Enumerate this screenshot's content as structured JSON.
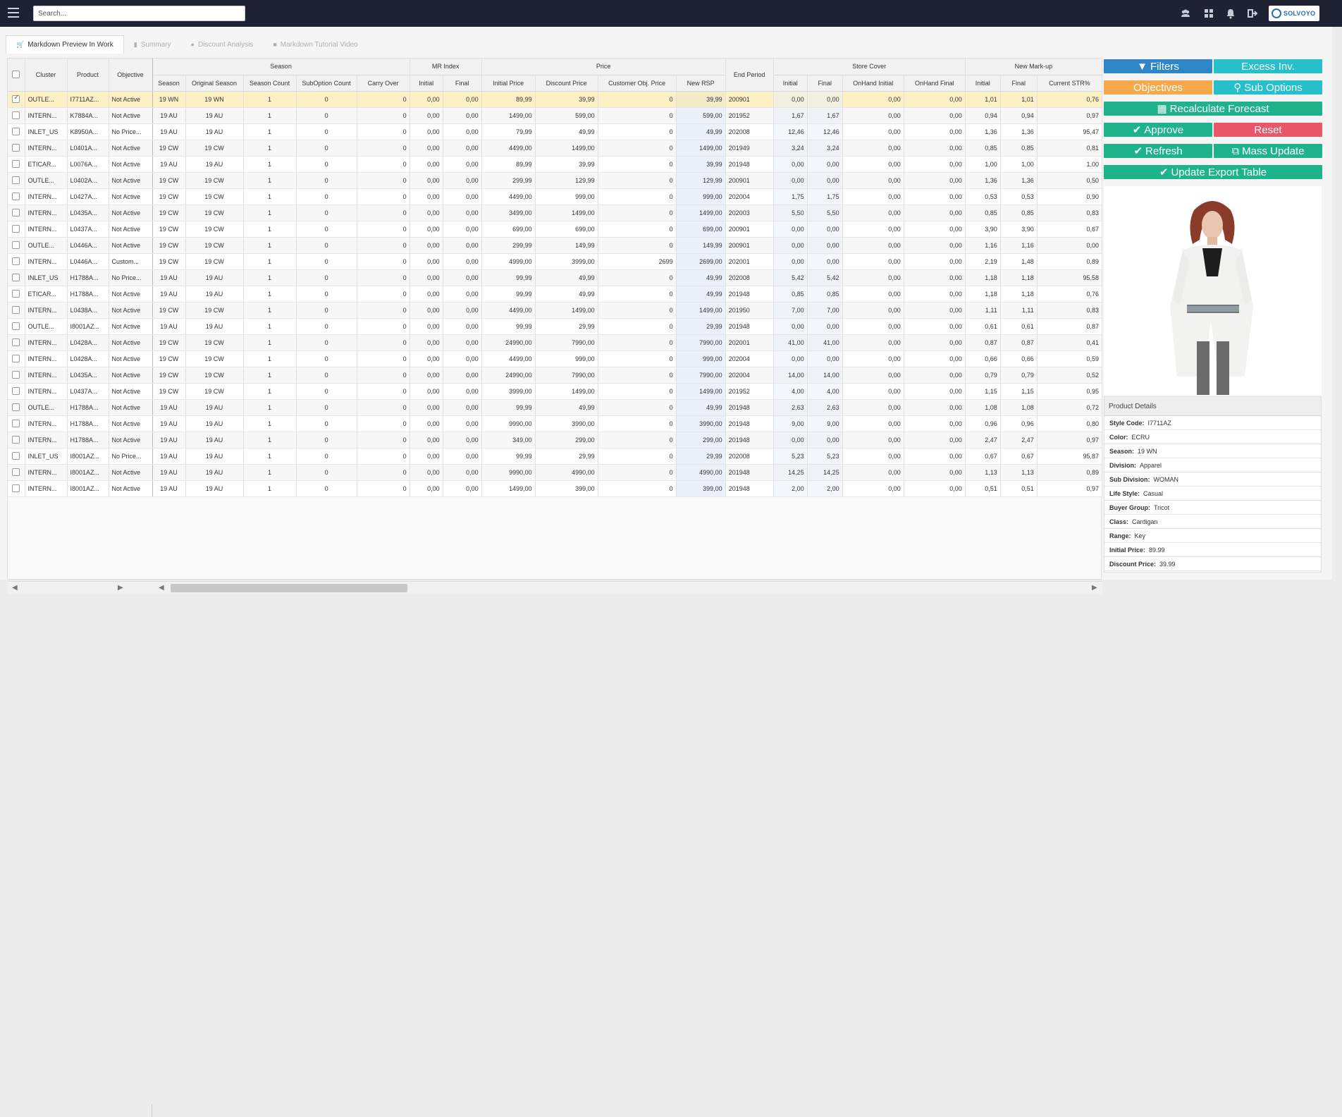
{
  "search": {
    "placeholder": "Search..."
  },
  "logo": {
    "text": "SOLVOYO"
  },
  "tabs": [
    {
      "label": "Markdown Preview In Work",
      "icon": "cart-icon",
      "active": true
    },
    {
      "label": "Summary",
      "icon": "bar-chart-icon",
      "active": false
    },
    {
      "label": "Discount Analysis",
      "icon": "pie-chart-icon",
      "active": false
    },
    {
      "label": "Markdown Tutorial Video",
      "icon": "video-icon",
      "active": false
    }
  ],
  "grid": {
    "group_headers": {
      "season": "Season",
      "mr_index": "MR Index",
      "price": "Price",
      "store_cover": "Store Cover",
      "new_markup": "New Mark-up"
    },
    "frozen_headers": {
      "cluster": "Cluster",
      "product": "Product",
      "objective": "Objective"
    },
    "end_period_header": "End Period",
    "sub_headers": {
      "season": "Season",
      "original_season": "Original Season",
      "season_count": "Season Count",
      "suboption_count": "SubOption Count",
      "carry_over": "Carry Over",
      "mr_initial": "Initial",
      "mr_final": "Final",
      "initial_price": "Initial Price",
      "discount_price": "Discount Price",
      "customer_obj_price": "Customer Obj. Price",
      "new_rsp": "New RSP",
      "sc_initial": "Initial",
      "sc_final": "Final",
      "onhand_initial": "OnHand Initial",
      "onhand_final": "OnHand Final",
      "nm_initial": "Initial",
      "nm_final": "Final",
      "current_str": "Current STR%"
    },
    "rows": [
      [
        "OUTLE...",
        "I7711AZ...",
        "Not Active",
        "19 WN",
        "19 WN",
        "1",
        "0",
        "0",
        "0,00",
        "0,00",
        "89,99",
        "39,99",
        "0",
        "39,99",
        "200901",
        "0,00",
        "0,00",
        "0,00",
        "0,00",
        "1,01",
        "1,01",
        "0,76"
      ],
      [
        "INTERN...",
        "K7884A...",
        "Not Active",
        "19 AU",
        "19 AU",
        "1",
        "0",
        "0",
        "0,00",
        "0,00",
        "1499,00",
        "599,00",
        "0",
        "599,00",
        "201952",
        "1,67",
        "1,67",
        "0,00",
        "0,00",
        "0,94",
        "0,94",
        "0,97"
      ],
      [
        "INLET_US",
        "K8950A...",
        "No Price...",
        "19 AU",
        "19 AU",
        "1",
        "0",
        "0",
        "0,00",
        "0,00",
        "79,99",
        "49,99",
        "0",
        "49,99",
        "202008",
        "12,46",
        "12,46",
        "0,00",
        "0,00",
        "1,36",
        "1,36",
        "95,47"
      ],
      [
        "INTERN...",
        "L0401A...",
        "Not Active",
        "19 CW",
        "19 CW",
        "1",
        "0",
        "0",
        "0,00",
        "0,00",
        "4499,00",
        "1499,00",
        "0",
        "1499,00",
        "201949",
        "3,24",
        "3,24",
        "0,00",
        "0,00",
        "0,85",
        "0,85",
        "0,81"
      ],
      [
        "ETICAR...",
        "L0076A...",
        "Not Active",
        "19 AU",
        "19 AU",
        "1",
        "0",
        "0",
        "0,00",
        "0,00",
        "89,99",
        "39,99",
        "0",
        "39,99",
        "201948",
        "0,00",
        "0,00",
        "0,00",
        "0,00",
        "1,00",
        "1,00",
        "1,00"
      ],
      [
        "OUTLE...",
        "L0402A...",
        "Not Active",
        "19 CW",
        "19 CW",
        "1",
        "0",
        "0",
        "0,00",
        "0,00",
        "299,99",
        "129,99",
        "0",
        "129,99",
        "200901",
        "0,00",
        "0,00",
        "0,00",
        "0,00",
        "1,36",
        "1,36",
        "0,50"
      ],
      [
        "INTERN...",
        "L0427A...",
        "Not Active",
        "19 CW",
        "19 CW",
        "1",
        "0",
        "0",
        "0,00",
        "0,00",
        "4499,00",
        "999,00",
        "0",
        "999,00",
        "202004",
        "1,75",
        "1,75",
        "0,00",
        "0,00",
        "0,53",
        "0,53",
        "0,90"
      ],
      [
        "INTERN...",
        "L0435A...",
        "Not Active",
        "19 CW",
        "19 CW",
        "1",
        "0",
        "0",
        "0,00",
        "0,00",
        "3499,00",
        "1499,00",
        "0",
        "1499,00",
        "202003",
        "5,50",
        "5,50",
        "0,00",
        "0,00",
        "0,85",
        "0,85",
        "0,83"
      ],
      [
        "INTERN...",
        "L0437A...",
        "Not Active",
        "19 CW",
        "19 CW",
        "1",
        "0",
        "0",
        "0,00",
        "0,00",
        "699,00",
        "699,00",
        "0",
        "699,00",
        "200901",
        "0,00",
        "0,00",
        "0,00",
        "0,00",
        "3,90",
        "3,90",
        "0,67"
      ],
      [
        "OUTLE...",
        "L0446A...",
        "Not Active",
        "19 CW",
        "19 CW",
        "1",
        "0",
        "0",
        "0,00",
        "0,00",
        "299,99",
        "149,99",
        "0",
        "149,99",
        "200901",
        "0,00",
        "0,00",
        "0,00",
        "0,00",
        "1,16",
        "1,16",
        "0,00"
      ],
      [
        "INTERN...",
        "L0446A...",
        "Custom...",
        "19 CW",
        "19 CW",
        "1",
        "0",
        "0",
        "0,00",
        "0,00",
        "4999,00",
        "3999,00",
        "2699",
        "2699,00",
        "202001",
        "0,00",
        "0,00",
        "0,00",
        "0,00",
        "2,19",
        "1,48",
        "0,89"
      ],
      [
        "INLET_US",
        "H1788A...",
        "No Price...",
        "19 AU",
        "19 AU",
        "1",
        "0",
        "0",
        "0,00",
        "0,00",
        "99,99",
        "49,99",
        "0",
        "49,99",
        "202008",
        "5,42",
        "5,42",
        "0,00",
        "0,00",
        "1,18",
        "1,18",
        "95,58"
      ],
      [
        "ETICAR...",
        "H1788A...",
        "Not Active",
        "19 AU",
        "19 AU",
        "1",
        "0",
        "0",
        "0,00",
        "0,00",
        "99,99",
        "49,99",
        "0",
        "49,99",
        "201948",
        "0,85",
        "0,85",
        "0,00",
        "0,00",
        "1,18",
        "1,18",
        "0,76"
      ],
      [
        "INTERN...",
        "L0438A...",
        "Not Active",
        "19 CW",
        "19 CW",
        "1",
        "0",
        "0",
        "0,00",
        "0,00",
        "4499,00",
        "1499,00",
        "0",
        "1499,00",
        "201950",
        "7,00",
        "7,00",
        "0,00",
        "0,00",
        "1,11",
        "1,11",
        "0,83"
      ],
      [
        "OUTLE...",
        "I8001AZ...",
        "Not Active",
        "19 AU",
        "19 AU",
        "1",
        "0",
        "0",
        "0,00",
        "0,00",
        "99,99",
        "29,99",
        "0",
        "29,99",
        "201948",
        "0,00",
        "0,00",
        "0,00",
        "0,00",
        "0,61",
        "0,61",
        "0,87"
      ],
      [
        "INTERN...",
        "L0428A...",
        "Not Active",
        "19 CW",
        "19 CW",
        "1",
        "0",
        "0",
        "0,00",
        "0,00",
        "24990,00",
        "7990,00",
        "0",
        "7990,00",
        "202001",
        "41,00",
        "41,00",
        "0,00",
        "0,00",
        "0,87",
        "0,87",
        "0,41"
      ],
      [
        "INTERN...",
        "L0428A...",
        "Not Active",
        "19 CW",
        "19 CW",
        "1",
        "0",
        "0",
        "0,00",
        "0,00",
        "4499,00",
        "999,00",
        "0",
        "999,00",
        "202004",
        "0,00",
        "0,00",
        "0,00",
        "0,00",
        "0,66",
        "0,66",
        "0,59"
      ],
      [
        "INTERN...",
        "L0435A...",
        "Not Active",
        "19 CW",
        "19 CW",
        "1",
        "0",
        "0",
        "0,00",
        "0,00",
        "24990,00",
        "7990,00",
        "0",
        "7990,00",
        "202004",
        "14,00",
        "14,00",
        "0,00",
        "0,00",
        "0,79",
        "0,79",
        "0,52"
      ],
      [
        "INTERN...",
        "L0437A...",
        "Not Active",
        "19 CW",
        "19 CW",
        "1",
        "0",
        "0",
        "0,00",
        "0,00",
        "3999,00",
        "1499,00",
        "0",
        "1499,00",
        "201952",
        "4,00",
        "4,00",
        "0,00",
        "0,00",
        "1,15",
        "1,15",
        "0,95"
      ],
      [
        "OUTLE...",
        "H1788A...",
        "Not Active",
        "19 AU",
        "19 AU",
        "1",
        "0",
        "0",
        "0,00",
        "0,00",
        "99,99",
        "49,99",
        "0",
        "49,99",
        "201948",
        "2,63",
        "2,63",
        "0,00",
        "0,00",
        "1,08",
        "1,08",
        "0,72"
      ],
      [
        "INTERN...",
        "H1788A...",
        "Not Active",
        "19 AU",
        "19 AU",
        "1",
        "0",
        "0",
        "0,00",
        "0,00",
        "9990,00",
        "3990,00",
        "0",
        "3990,00",
        "201948",
        "9,00",
        "9,00",
        "0,00",
        "0,00",
        "0,96",
        "0,96",
        "0,80"
      ],
      [
        "INTERN...",
        "H1788A...",
        "Not Active",
        "19 AU",
        "19 AU",
        "1",
        "0",
        "0",
        "0,00",
        "0,00",
        "349,00",
        "299,00",
        "0",
        "299,00",
        "201948",
        "0,00",
        "0,00",
        "0,00",
        "0,00",
        "2,47",
        "2,47",
        "0,97"
      ],
      [
        "INLET_US",
        "I8001AZ...",
        "No Price...",
        "19 AU",
        "19 AU",
        "1",
        "0",
        "0",
        "0,00",
        "0,00",
        "99,99",
        "29,99",
        "0",
        "29,99",
        "202008",
        "5,23",
        "5,23",
        "0,00",
        "0,00",
        "0,67",
        "0,67",
        "95,87"
      ],
      [
        "INTERN...",
        "I8001AZ...",
        "Not Active",
        "19 AU",
        "19 AU",
        "1",
        "0",
        "0",
        "0,00",
        "0,00",
        "9990,00",
        "4990,00",
        "0",
        "4990,00",
        "201948",
        "14,25",
        "14,25",
        "0,00",
        "0,00",
        "1,13",
        "1,13",
        "0,89"
      ],
      [
        "INTERN...",
        "I8001AZ...",
        "Not Active",
        "19 AU",
        "19 AU",
        "1",
        "0",
        "0",
        "0,00",
        "0,00",
        "1499,00",
        "399,00",
        "0",
        "399,00",
        "201948",
        "2,00",
        "2,00",
        "0,00",
        "0,00",
        "0,51",
        "0,51",
        "0,97"
      ]
    ],
    "selected_row": 0
  },
  "buttons": {
    "filters": "Filters",
    "excess_inv": "Excess Inv.",
    "objectives": "Objectives",
    "sub_options": "Sub Options",
    "recalculate": "Recalculate Forecast",
    "approve": "Approve",
    "reset": "Reset",
    "refresh": "Refresh",
    "mass_update": "Mass Update",
    "update_export": "Update Export Table"
  },
  "product_details": {
    "title": "Product Details",
    "fields": [
      {
        "label": "Style Code:",
        "value": "I7711AZ"
      },
      {
        "label": "Color:",
        "value": "ECRU"
      },
      {
        "label": "Season:",
        "value": "19 WN"
      },
      {
        "label": "Division:",
        "value": "Apparel"
      },
      {
        "label": "Sub Division:",
        "value": "WOMAN"
      },
      {
        "label": "Life Style:",
        "value": "Casual"
      },
      {
        "label": "Buyer Group:",
        "value": "Tricot"
      },
      {
        "label": "Class:",
        "value": "Cardigan"
      },
      {
        "label": "Range:",
        "value": "Key"
      },
      {
        "label": "Initial Price:",
        "value": "89.99"
      },
      {
        "label": "Discount Price:",
        "value": "39.99"
      }
    ]
  },
  "colors": {
    "topbar": "#1e2232",
    "blue": "#2e86c9",
    "teal": "#25c0c9",
    "orange": "#f6a94b",
    "green": "#1fb38b",
    "red": "#e9566a",
    "selected_row": "#fdf0c4"
  }
}
